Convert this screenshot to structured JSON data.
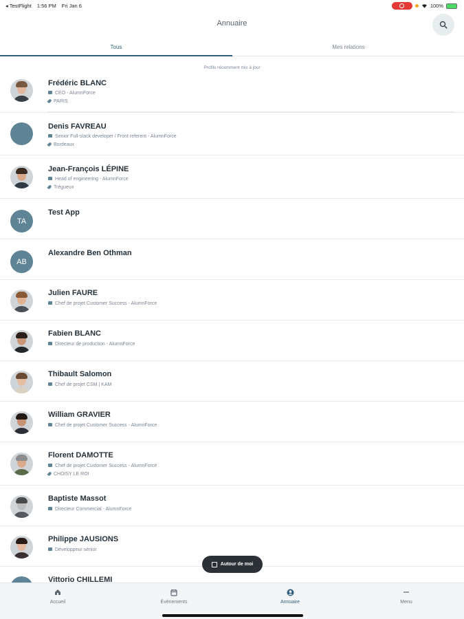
{
  "status": {
    "carrier": "◂ TestFlight",
    "time": "1:56 PM",
    "date": "Fri Jan 6",
    "battery": "100%"
  },
  "header": {
    "title": "Annuaire"
  },
  "tabs": [
    {
      "label": "Tous"
    },
    {
      "label": "Mes relations"
    }
  ],
  "section_label": "Profils récemment mis à jour",
  "people": [
    {
      "name": "Frédéric BLANC",
      "job": "CEO - AlumnForce",
      "location": "PARIS"
    },
    {
      "name": "Denis FAVREAU",
      "job": "Senior Full-stack developer / Front referent - AlumnForce",
      "location": "Bordeaux"
    },
    {
      "name": "Jean-François LÉPINE",
      "job": "Head of engineering - AlumnForce",
      "location": "Trégueux"
    },
    {
      "name": "Test App",
      "initials": "TA"
    },
    {
      "name": "Alexandre Ben Othman",
      "initials": "AB"
    },
    {
      "name": "Julien FAURE",
      "job": "Chef de projet Customer Success - AlumnForce"
    },
    {
      "name": "Fabien BLANC",
      "job": "Directeur de production - AlumnForce"
    },
    {
      "name": "Thibault Salomon",
      "job": "Chef de projet CSM | KAM"
    },
    {
      "name": "William GRAVIER",
      "job": "Chef de projet Customer Success - AlumnForce"
    },
    {
      "name": "Florent DAMOTTE",
      "job": "Chef de projet Customer Success - AlumnForce",
      "location": "CHOISY LE ROI"
    },
    {
      "name": "Baptiste Massot",
      "job": "Directeur Commercial - AlumnForce"
    },
    {
      "name": "Philippe JAUSIONS",
      "job": "Développeur sénior"
    },
    {
      "name": "Vittorio CHILLEMI"
    }
  ],
  "fab": {
    "label": "Autour de moi"
  },
  "bottom_nav": [
    {
      "label": "Accueil",
      "icon": "home-icon"
    },
    {
      "label": "Événements",
      "icon": "calendar-icon"
    },
    {
      "label": "Annuaire",
      "icon": "person-icon"
    },
    {
      "label": "Menu",
      "icon": "menu-icon"
    }
  ],
  "colors": {
    "accent": "#2e5f7d",
    "avatar": "#5e8496",
    "fab": "#2b3136"
  }
}
